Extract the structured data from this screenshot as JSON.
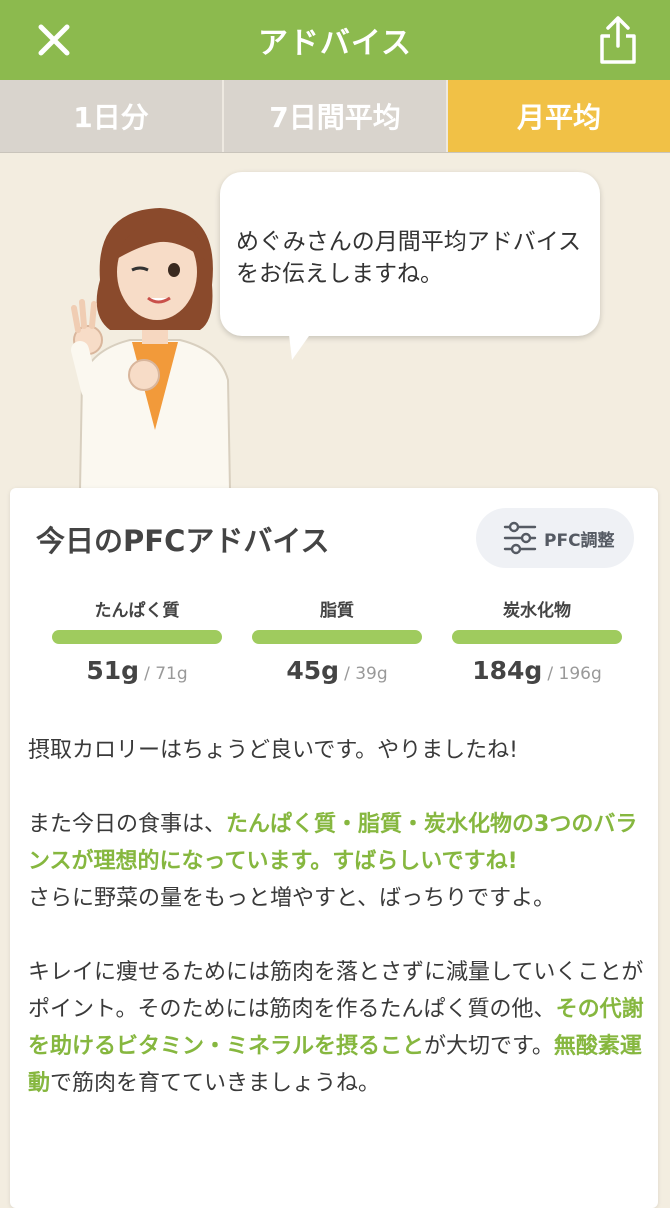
{
  "header": {
    "title": "アドバイス",
    "close_icon": "close-icon",
    "share_icon": "share-icon",
    "background_color": "#8cba4e"
  },
  "tabs": [
    {
      "label": "1日分",
      "active": false
    },
    {
      "label": "7日間平均",
      "active": false
    },
    {
      "label": "月平均",
      "active": true
    }
  ],
  "tab_active_color": "#f1c146",
  "speech": {
    "line1": "めぐみさんの月間平均アドバイス",
    "line2": "をお伝えしますね。"
  },
  "card": {
    "title": "今日のPFCアドバイス",
    "pfc_button_label": "PFC調整",
    "pfc_button_icon": "sliders-icon",
    "nutrients": [
      {
        "name": "たんぱく質",
        "actual": "51g",
        "target": "/ 71g"
      },
      {
        "name": "脂質",
        "actual": "45g",
        "target": "/ 39g"
      },
      {
        "name": "炭水化物",
        "actual": "184g",
        "target": "/ 196g"
      }
    ],
    "bar_color": "#9fcb5e",
    "highlight_color": "#86b73f"
  },
  "advice": {
    "p1": "摂取カロリーはちょうど良いです。やりましたね!",
    "p2_a": "また今日の食事は、",
    "p2_hl": "たんぱく質・脂質・炭水化物の3つのバランスが理想的になっています。すばらしいですね!",
    "p2_b": "さらに野菜の量をもっと増やすと、ばっちりですよ。",
    "p3_a": "キレイに痩せるためには筋肉を落とさずに減量していくことがポイント。そのためには筋肉を作るたんぱく質の他、",
    "p3_hl1": "その代謝を助けるビタミン・ミネラルを摂ること",
    "p3_b": "が大切です。",
    "p3_hl2": "無酸素運動",
    "p3_c": "で筋肉を育てていきましょうね。"
  }
}
